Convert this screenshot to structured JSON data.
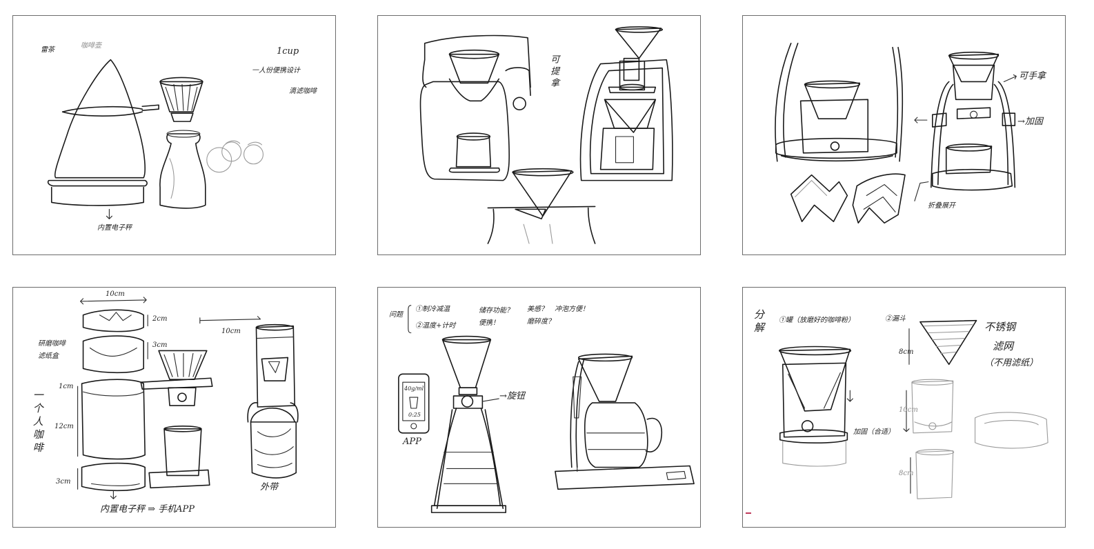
{
  "sketches": [
    {
      "id": "kettle-dripper",
      "notes": {
        "top_left_a": "雷茶",
        "top_left_b": "咖啡壶",
        "cup": "1cup",
        "portable": "一人份便携设计",
        "brew": "滴滤咖啡",
        "bottom": "内置电子秤"
      }
    },
    {
      "id": "handle-stand",
      "notes": {
        "handle": "可提拿"
      }
    },
    {
      "id": "tripod-stand",
      "notes": {
        "holdable": "可手拿",
        "fixed": "→加固",
        "folding": "折叠展开"
      }
    },
    {
      "id": "stack-dimensions",
      "notes": {
        "width": "10cm",
        "dim_2cm": "2cm",
        "dim_3cm_a": "3cm",
        "dim_1cm_a": "1cm",
        "dim_12cm": "12cm",
        "dim_3cm_b": "3cm",
        "dim_10cm_b": "10cm",
        "grind": "研磨咖啡",
        "filter": "滤纸盒",
        "vertical": "一个人咖啡",
        "scale_app": "内置电子秤 ⇒ 手机APP",
        "carry": "外带"
      }
    },
    {
      "id": "app-scale",
      "notes": {
        "problem": "问题",
        "q1": "①制冷减温",
        "q2": "②温度+计时",
        "storage": "储存功能？",
        "beauty": "美感？",
        "convenient": "冲泡方便！",
        "portable": "便携！",
        "grind": "磨碎度？",
        "rotate": "→旋钮",
        "phone_time": "0:25",
        "phone_weight": "40g/ml",
        "app": "APP"
      }
    },
    {
      "id": "decompose",
      "notes": {
        "split": "分解",
        "item1": "①罐（放磨好的咖啡粉）",
        "item2": "②漏斗",
        "steel": "不锈钢",
        "mesh": "滤网",
        "no_paper": "（不用滤纸）",
        "dim_8cm_a": "8cm",
        "dim_10cm": "10cm",
        "dim_8cm_b": "8cm",
        "base": "加固（合适）"
      }
    }
  ]
}
